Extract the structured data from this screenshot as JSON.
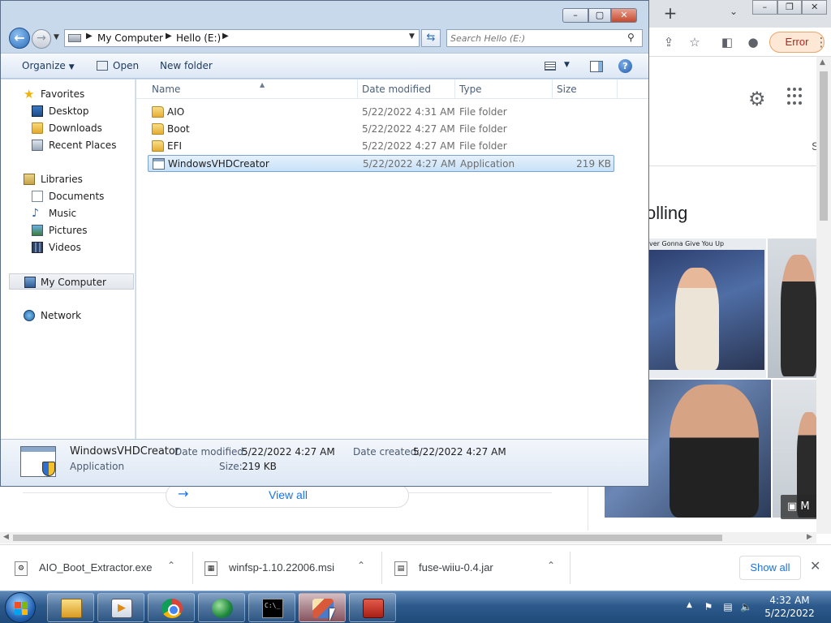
{
  "chrome": {
    "error_label": "Error",
    "search_fragment": "S",
    "result_heading_fragment": "olling",
    "image_caption_fragment": "ver Gonna Give You Up",
    "view_all_label": "View all",
    "downloads": [
      {
        "name": "AIO_Boot_Extractor.exe"
      },
      {
        "name": "winfsp-1.10.22006.msi"
      },
      {
        "name": "fuse-wiiu-0.4.jar"
      }
    ],
    "show_all_label": "Show all"
  },
  "explorer": {
    "address": {
      "crumb1": "My Computer",
      "crumb2": "Hello (E:)"
    },
    "search_placeholder": "Search Hello (E:)",
    "commands": {
      "organize": "Organize",
      "open": "Open",
      "new_folder": "New folder"
    },
    "nav": {
      "favorites": "Favorites",
      "desktop": "Desktop",
      "downloads": "Downloads",
      "recent_places": "Recent Places",
      "libraries": "Libraries",
      "documents": "Documents",
      "music": "Music",
      "pictures": "Pictures",
      "videos": "Videos",
      "my_computer": "My Computer",
      "network": "Network"
    },
    "columns": {
      "name": "Name",
      "date": "Date modified",
      "type": "Type",
      "size": "Size"
    },
    "files": [
      {
        "name": "AIO",
        "date": "5/22/2022 4:31 AM",
        "type": "File folder",
        "size": ""
      },
      {
        "name": "Boot",
        "date": "5/22/2022 4:27 AM",
        "type": "File folder",
        "size": ""
      },
      {
        "name": "EFI",
        "date": "5/22/2022 4:27 AM",
        "type": "File folder",
        "size": ""
      },
      {
        "name": "WindowsVHDCreator",
        "date": "5/22/2022 4:27 AM",
        "type": "Application",
        "size": "219 KB"
      }
    ],
    "details": {
      "name": "WindowsVHDCreator",
      "type": "Application",
      "modified_label": "Date modified:",
      "modified_value": "5/22/2022 4:27 AM",
      "created_label": "Date created:",
      "created_value": "5/22/2022 4:27 AM",
      "size_label": "Size:",
      "size_value": "219 KB"
    }
  },
  "taskbar": {
    "time": "4:32 AM",
    "date": "5/22/2022"
  }
}
